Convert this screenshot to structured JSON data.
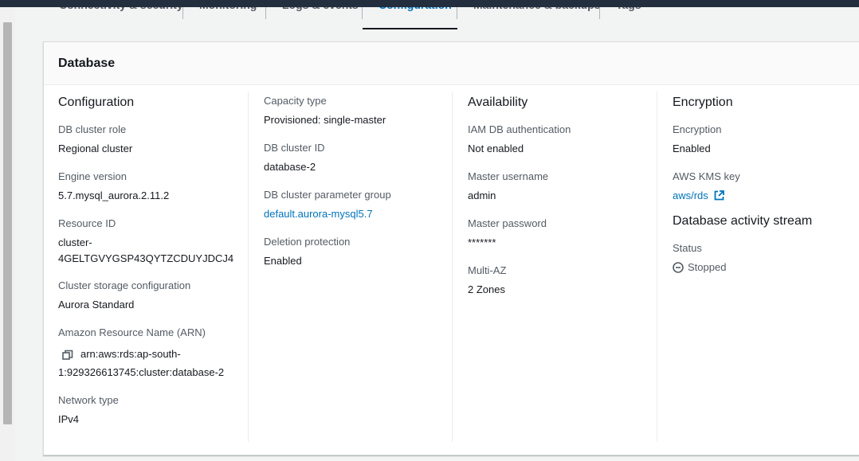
{
  "tabs": [
    {
      "label": "Connectivity & security"
    },
    {
      "label": "Monitoring"
    },
    {
      "label": "Logs & events"
    },
    {
      "label": "Configuration"
    },
    {
      "label": "Maintenance & backups"
    },
    {
      "label": "Tags"
    }
  ],
  "active_tab": "Configuration",
  "panel": {
    "title": "Database"
  },
  "configuration": {
    "heading": "Configuration",
    "db_cluster_role": {
      "label": "DB cluster role",
      "value": "Regional cluster"
    },
    "engine_version": {
      "label": "Engine version",
      "value": "5.7.mysql_aurora.2.11.2"
    },
    "resource_id": {
      "label": "Resource ID",
      "value_line1": "cluster-",
      "value_line2": "4GELTGVYGSP43QYTZCDUYJDCJ4"
    },
    "storage": {
      "label": "Cluster storage configuration",
      "value": "Aurora Standard"
    },
    "arn": {
      "label": "Amazon Resource Name (ARN)",
      "value_line1": "arn:aws:rds:ap-south-",
      "value_line2": "1:929326613745:cluster:database-2"
    },
    "network_type": {
      "label": "Network type",
      "value": "IPv4"
    }
  },
  "capacity": {
    "capacity_type": {
      "label": "Capacity type",
      "value": "Provisioned: single-master"
    },
    "db_cluster_id": {
      "label": "DB cluster ID",
      "value": "database-2"
    },
    "param_group": {
      "label": "DB cluster parameter group",
      "value": "default.aurora-mysql5.7"
    },
    "deletion_protection": {
      "label": "Deletion protection",
      "value": "Enabled"
    }
  },
  "availability": {
    "heading": "Availability",
    "iam_auth": {
      "label": "IAM DB authentication",
      "value": "Not enabled"
    },
    "master_username": {
      "label": "Master username",
      "value": "admin"
    },
    "master_password": {
      "label": "Master password",
      "value": "*******"
    },
    "multi_az": {
      "label": "Multi-AZ",
      "value": "2 Zones"
    }
  },
  "encryption": {
    "heading": "Encryption",
    "encryption": {
      "label": "Encryption",
      "value": "Enabled"
    },
    "kms_key": {
      "label": "AWS KMS key",
      "value": "aws/rds"
    },
    "activity_stream_heading": "Database activity stream",
    "status": {
      "label": "Status",
      "value": "Stopped"
    }
  },
  "colors": {
    "link": "#0073bb",
    "text": "#16191f",
    "label": "#545b64",
    "header_bg": "#232f3e"
  },
  "icons": {
    "copy": "copy-icon",
    "external": "external-link-icon",
    "stopped": "stopped-status-icon"
  }
}
